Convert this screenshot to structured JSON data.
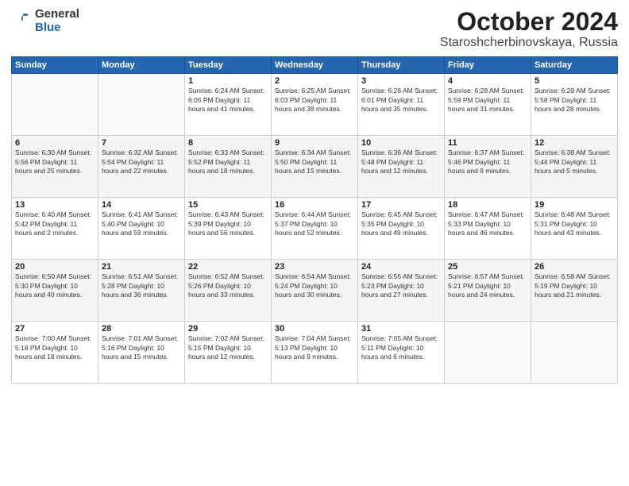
{
  "logo": {
    "general": "General",
    "blue": "Blue"
  },
  "title": "October 2024",
  "subtitle": "Staroshcherbinovskaya, Russia",
  "days_of_week": [
    "Sunday",
    "Monday",
    "Tuesday",
    "Wednesday",
    "Thursday",
    "Friday",
    "Saturday"
  ],
  "weeks": [
    [
      {
        "day": "",
        "info": ""
      },
      {
        "day": "",
        "info": ""
      },
      {
        "day": "1",
        "info": "Sunrise: 6:24 AM\nSunset: 6:05 PM\nDaylight: 11 hours and 41 minutes."
      },
      {
        "day": "2",
        "info": "Sunrise: 6:25 AM\nSunset: 6:03 PM\nDaylight: 11 hours and 38 minutes."
      },
      {
        "day": "3",
        "info": "Sunrise: 6:26 AM\nSunset: 6:01 PM\nDaylight: 11 hours and 35 minutes."
      },
      {
        "day": "4",
        "info": "Sunrise: 6:28 AM\nSunset: 5:59 PM\nDaylight: 11 hours and 31 minutes."
      },
      {
        "day": "5",
        "info": "Sunrise: 6:29 AM\nSunset: 5:58 PM\nDaylight: 11 hours and 28 minutes."
      }
    ],
    [
      {
        "day": "6",
        "info": "Sunrise: 6:30 AM\nSunset: 5:56 PM\nDaylight: 11 hours and 25 minutes."
      },
      {
        "day": "7",
        "info": "Sunrise: 6:32 AM\nSunset: 5:54 PM\nDaylight: 11 hours and 22 minutes."
      },
      {
        "day": "8",
        "info": "Sunrise: 6:33 AM\nSunset: 5:52 PM\nDaylight: 11 hours and 18 minutes."
      },
      {
        "day": "9",
        "info": "Sunrise: 6:34 AM\nSunset: 5:50 PM\nDaylight: 11 hours and 15 minutes."
      },
      {
        "day": "10",
        "info": "Sunrise: 6:36 AM\nSunset: 5:48 PM\nDaylight: 11 hours and 12 minutes."
      },
      {
        "day": "11",
        "info": "Sunrise: 6:37 AM\nSunset: 5:46 PM\nDaylight: 11 hours and 9 minutes."
      },
      {
        "day": "12",
        "info": "Sunrise: 6:38 AM\nSunset: 5:44 PM\nDaylight: 11 hours and 5 minutes."
      }
    ],
    [
      {
        "day": "13",
        "info": "Sunrise: 6:40 AM\nSunset: 5:42 PM\nDaylight: 11 hours and 2 minutes."
      },
      {
        "day": "14",
        "info": "Sunrise: 6:41 AM\nSunset: 5:40 PM\nDaylight: 10 hours and 59 minutes."
      },
      {
        "day": "15",
        "info": "Sunrise: 6:43 AM\nSunset: 5:39 PM\nDaylight: 10 hours and 56 minutes."
      },
      {
        "day": "16",
        "info": "Sunrise: 6:44 AM\nSunset: 5:37 PM\nDaylight: 10 hours and 52 minutes."
      },
      {
        "day": "17",
        "info": "Sunrise: 6:45 AM\nSunset: 5:35 PM\nDaylight: 10 hours and 49 minutes."
      },
      {
        "day": "18",
        "info": "Sunrise: 6:47 AM\nSunset: 5:33 PM\nDaylight: 10 hours and 46 minutes."
      },
      {
        "day": "19",
        "info": "Sunrise: 6:48 AM\nSunset: 5:31 PM\nDaylight: 10 hours and 43 minutes."
      }
    ],
    [
      {
        "day": "20",
        "info": "Sunrise: 6:50 AM\nSunset: 5:30 PM\nDaylight: 10 hours and 40 minutes."
      },
      {
        "day": "21",
        "info": "Sunrise: 6:51 AM\nSunset: 5:28 PM\nDaylight: 10 hours and 36 minutes."
      },
      {
        "day": "22",
        "info": "Sunrise: 6:52 AM\nSunset: 5:26 PM\nDaylight: 10 hours and 33 minutes."
      },
      {
        "day": "23",
        "info": "Sunrise: 6:54 AM\nSunset: 5:24 PM\nDaylight: 10 hours and 30 minutes."
      },
      {
        "day": "24",
        "info": "Sunrise: 6:55 AM\nSunset: 5:23 PM\nDaylight: 10 hours and 27 minutes."
      },
      {
        "day": "25",
        "info": "Sunrise: 6:57 AM\nSunset: 5:21 PM\nDaylight: 10 hours and 24 minutes."
      },
      {
        "day": "26",
        "info": "Sunrise: 6:58 AM\nSunset: 5:19 PM\nDaylight: 10 hours and 21 minutes."
      }
    ],
    [
      {
        "day": "27",
        "info": "Sunrise: 7:00 AM\nSunset: 5:18 PM\nDaylight: 10 hours and 18 minutes."
      },
      {
        "day": "28",
        "info": "Sunrise: 7:01 AM\nSunset: 5:16 PM\nDaylight: 10 hours and 15 minutes."
      },
      {
        "day": "29",
        "info": "Sunrise: 7:02 AM\nSunset: 5:15 PM\nDaylight: 10 hours and 12 minutes."
      },
      {
        "day": "30",
        "info": "Sunrise: 7:04 AM\nSunset: 5:13 PM\nDaylight: 10 hours and 9 minutes."
      },
      {
        "day": "31",
        "info": "Sunrise: 7:05 AM\nSunset: 5:11 PM\nDaylight: 10 hours and 6 minutes."
      },
      {
        "day": "",
        "info": ""
      },
      {
        "day": "",
        "info": ""
      }
    ]
  ]
}
